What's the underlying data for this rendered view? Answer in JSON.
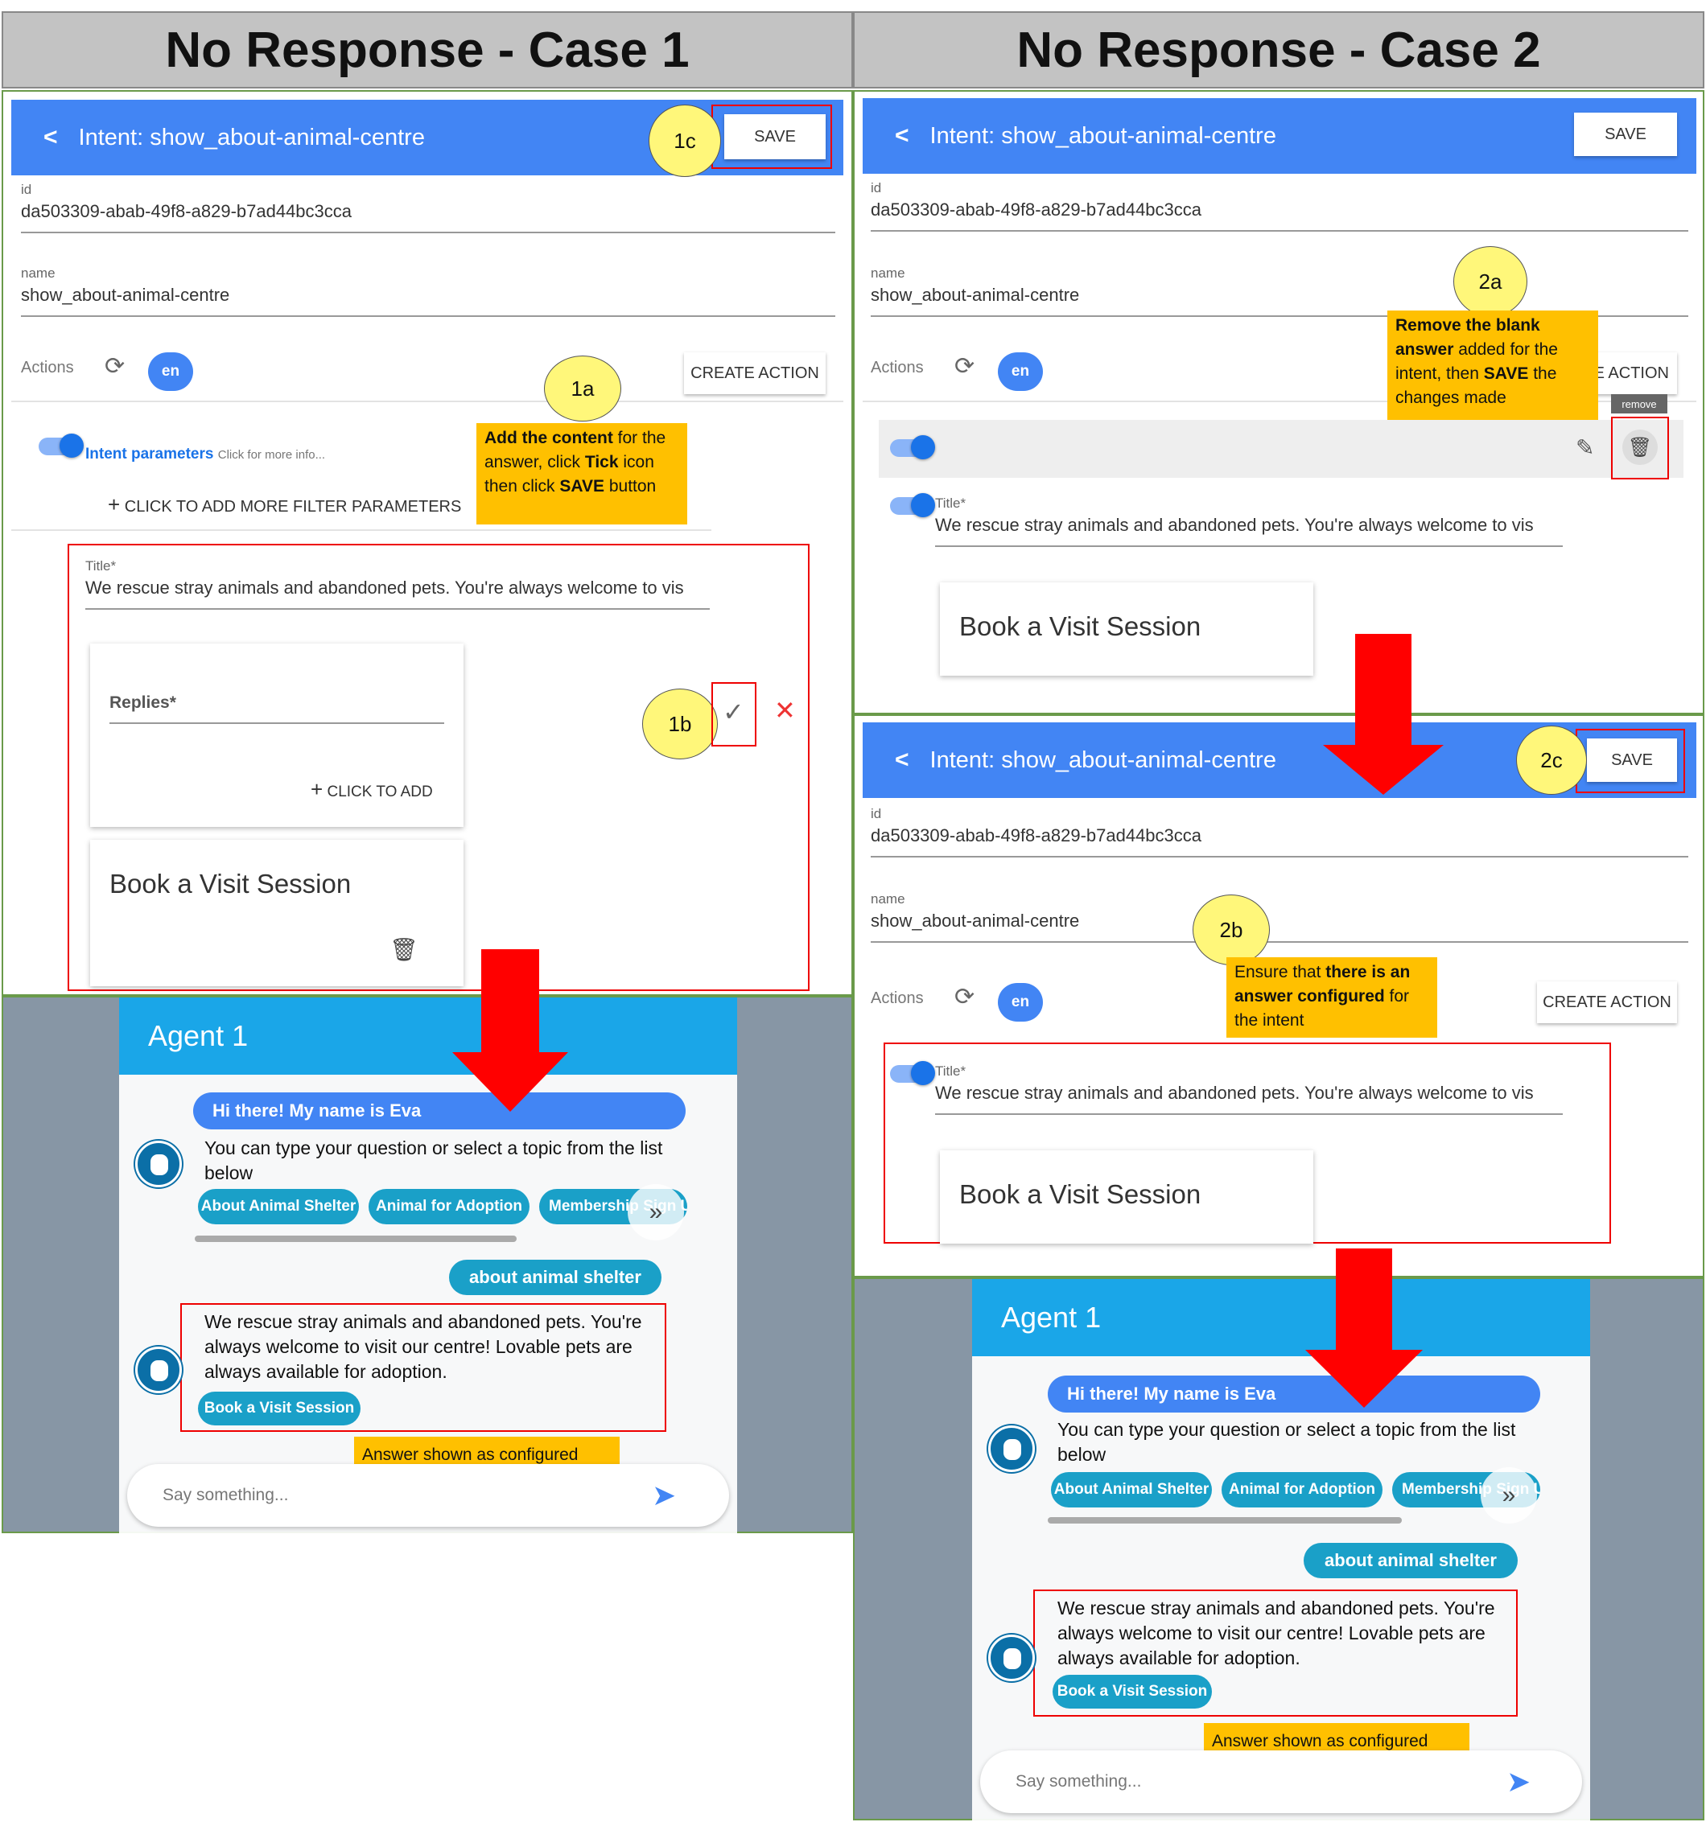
{
  "panels": {
    "case1_title": "No Response - Case 1",
    "case2_title": "No Response - Case 2"
  },
  "intent": {
    "title": "Intent: show_about-animal-centre",
    "save_label": "SAVE",
    "id_label": "id",
    "id_value": "da503309-abab-49f8-a829-b7ad44bc3cca",
    "name_label": "name",
    "name_value": "show_about-animal-centre",
    "actions_label": "Actions",
    "lang": "en",
    "create_action": "CREATE ACTION",
    "create_action_partial": "E ACTION",
    "intent_params": "Intent parameters",
    "click_more": "Click for more info...",
    "add_filter": "CLICK TO ADD MORE FILTER PARAMETERS",
    "title_label": "Title",
    "title_value": "We rescue stray animals and abandoned pets. You're always welcome to vis",
    "replies_label": "Replies",
    "click_to_add": "CLICK TO ADD",
    "button_text": "Book a Visit Session",
    "remove_tooltip": "remove"
  },
  "steps": {
    "s1a": "1a",
    "s1b": "1b",
    "s1c": "1c",
    "s2a": "2a",
    "s2b": "2b",
    "s2c": "2c"
  },
  "notes": {
    "n1a_p1": "Add the content",
    "n1a_p2": " for the answer, click ",
    "n1a_p3": "Tick",
    "n1a_p4": " icon then click ",
    "n1a_p5": "SAVE",
    "n1a_p6": " button",
    "n2a_p1": "Remove the blank answer",
    "n2a_p2": " added for the intent, then ",
    "n2a_p3": "SAVE",
    "n2a_p4": " the changes made",
    "n2b_p1": "Ensure that ",
    "n2b_p2": "there is an answer configured",
    "n2b_p3": " for the intent",
    "answer_shown": "Answer shown as configured"
  },
  "chat": {
    "agent_name": "Agent 1",
    "greeting": "Hi there! My name is Eva",
    "prompt": "You can type your question or select a topic from the list below",
    "chips": [
      "About Animal Shelter",
      "Animal for Adoption",
      "Membership Sign Up"
    ],
    "user_msg": "about animal shelter",
    "answer": "We rescue stray animals and abandoned pets. You're always welcome to visit our centre! Lovable pets are always available for adoption.",
    "answer_button": "Book a Visit Session",
    "input_placeholder": "Say something..."
  },
  "colors": {
    "app_bar": "#4285f4",
    "chat_header": "#1aa6e8",
    "chip": "#1aa0c8",
    "highlight_red": "#e00000",
    "note_yellow": "#ffc000",
    "step_circle": "#fff77a"
  }
}
